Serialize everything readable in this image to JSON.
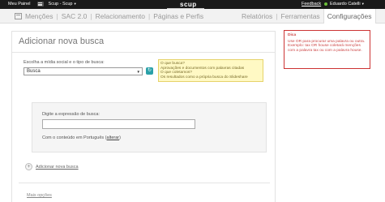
{
  "topbar": {
    "menu_label": "Meu Painel",
    "account_label": "Scup - Scup",
    "logo_text": "scup",
    "feedback_label": "Feedback",
    "user_label": "Eduardo Catelli"
  },
  "nav": {
    "left": [
      "Menções",
      "SAC 2.0",
      "Relacionamento",
      "Páginas e Perfis"
    ],
    "right": [
      "Relatórios",
      "Ferramentas",
      "Configurações"
    ],
    "separator": "|"
  },
  "main": {
    "title": "Adicionar nova busca",
    "choose_label": "Escolha a mídia social e o tipo de busca:",
    "select_value": "Busca",
    "help": {
      "line1": "O que busca?",
      "line2": "Aprovações e documentos com palavras citadas",
      "line3": "O que coletamos?",
      "line4": "Os resultados como a própria busca do Slideshare"
    },
    "expr_label": "Digite a expressão de busca:",
    "lang_prefix": "Com o conteúdo em Português",
    "lang_link": "alterar",
    "add_search_label": "Adicionar nova busca",
    "more_options": "Mais opções"
  },
  "tip": {
    "title": "Dica",
    "body": "Use OR para procurar uma palavra ou outra. Exemplo: tax OR house coletará menções com a palavra tax ou com a palavra house."
  },
  "colors": {
    "accent": "#2aa0a8",
    "tip_border": "#cc3333",
    "help_bg": "#fff9c4",
    "status_online": "#6bbf3a"
  }
}
